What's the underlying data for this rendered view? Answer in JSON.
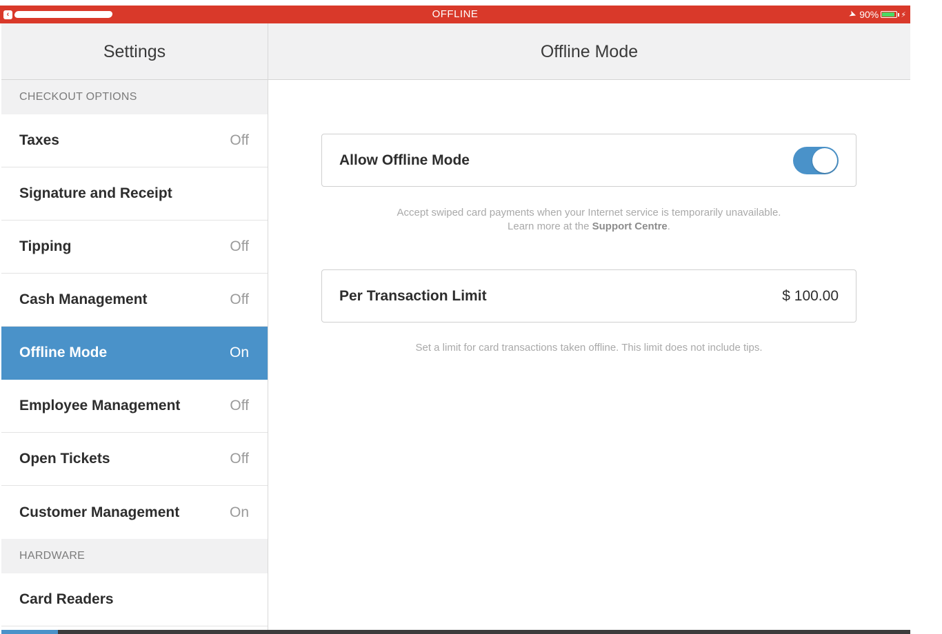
{
  "status_bar": {
    "center_text": "OFFLINE",
    "battery_text": "90%",
    "location_icon": "location-arrow-icon",
    "battery_icon": "battery-icon",
    "color": "#d9392a"
  },
  "sidebar": {
    "title": "Settings",
    "sections": [
      {
        "header": "CHECKOUT OPTIONS",
        "items": [
          {
            "label": "Taxes",
            "value": "Off"
          },
          {
            "label": "Signature and Receipt",
            "value": ""
          },
          {
            "label": "Tipping",
            "value": "Off"
          },
          {
            "label": "Cash Management",
            "value": "Off"
          },
          {
            "label": "Offline Mode",
            "value": "On",
            "active": true
          },
          {
            "label": "Employee Management",
            "value": "Off"
          },
          {
            "label": "Open Tickets",
            "value": "Off"
          },
          {
            "label": "Customer Management",
            "value": "On"
          }
        ]
      },
      {
        "header": "HARDWARE",
        "items": [
          {
            "label": "Card Readers",
            "value": ""
          }
        ]
      }
    ]
  },
  "main": {
    "title": "Offline Mode",
    "allow_offline": {
      "label": "Allow Offline Mode",
      "enabled": true,
      "help_line1": "Accept swiped card payments when your Internet service is temporarily unavailable.",
      "help_line2_prefix": "Learn more at the ",
      "help_link": "Support Centre",
      "help_line2_suffix": "."
    },
    "limit": {
      "label": "Per Transaction Limit",
      "value": "$ 100.00",
      "help": "Set a limit for card transactions taken offline. This limit does not include tips."
    }
  },
  "colors": {
    "accent": "#4a92c9",
    "offline_banner": "#d9392a"
  }
}
